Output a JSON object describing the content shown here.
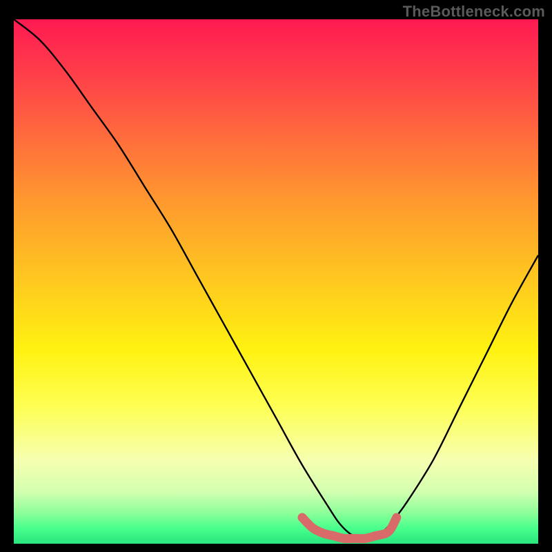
{
  "watermark": "TheBottleneck.com",
  "colors": {
    "page_bg": "#000000",
    "curve": "#000000",
    "marker": "#d86a6a",
    "gradient_top": "#ff1a52",
    "gradient_bottom": "#27e57e"
  },
  "chart_data": {
    "type": "line",
    "title": "",
    "xlabel": "",
    "ylabel": "",
    "xlim": [
      0,
      100
    ],
    "ylim": [
      0,
      100
    ],
    "grid": false,
    "legend": false,
    "series": [
      {
        "name": "bottleneck-curve",
        "x": [
          0,
          5,
          10,
          15,
          20,
          25,
          30,
          35,
          40,
          45,
          50,
          55,
          60,
          62,
          64,
          66,
          68,
          70,
          72,
          75,
          80,
          85,
          90,
          95,
          100
        ],
        "y": [
          100,
          96,
          90,
          83,
          76,
          68,
          60,
          51,
          42,
          33,
          24,
          15,
          7,
          4,
          2,
          1,
          1,
          2,
          4,
          8,
          16,
          26,
          36,
          46,
          55
        ]
      },
      {
        "name": "optimal-marker",
        "x": [
          55,
          57,
          59,
          61,
          63,
          65,
          67,
          69,
          71,
          72,
          73
        ],
        "y": [
          5,
          3,
          2,
          1.5,
          1,
          1,
          1,
          1.5,
          2,
          3,
          5
        ]
      }
    ],
    "annotations": []
  }
}
